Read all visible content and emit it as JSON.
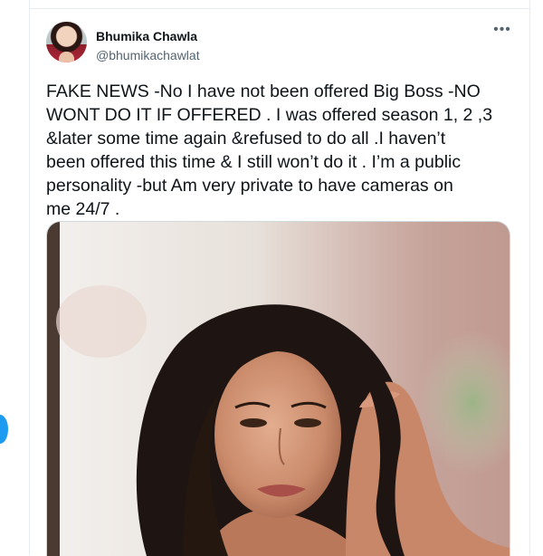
{
  "tweet": {
    "display_name": "Bhumika Chawla",
    "handle": "@bhumikachawlat",
    "more_icon": "more-horizontal-icon",
    "text_lines": [
      "FAKE NEWS -No I have not been offered Big Boss -NO",
      "WONT DO IT IF OFFERED . I was offered season 1, 2 ,3",
      "&later some time again &refused to do all .I haven’t",
      "been offered this time & I still won’t do it . I’m a public",
      "personality -but Am very private to have cameras on",
      "me 24/7 ."
    ]
  },
  "colors": {
    "accent": "#1d9bf0",
    "text": "#0f1419",
    "muted": "#536471",
    "border": "#e6ecf0"
  }
}
